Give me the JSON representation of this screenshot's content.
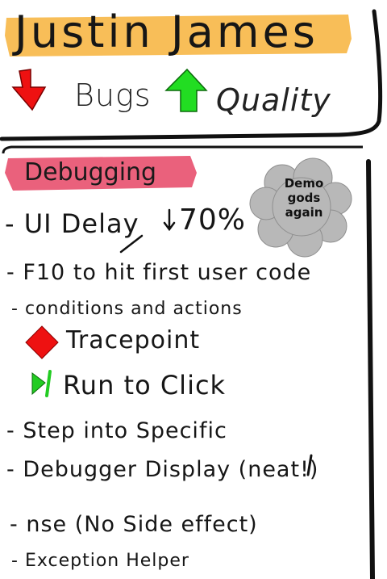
{
  "header": {
    "title": "Justin James",
    "bugs_label": "Bugs",
    "quality_label": "Quality",
    "colors": {
      "highlight": "#f7b84a",
      "down_arrow": "#ee1111",
      "up_arrow": "#22dd22"
    }
  },
  "section": {
    "title": "Debugging",
    "highlight_color": "#e8506e"
  },
  "cloud": {
    "line1": "Demo",
    "line2": "gods",
    "line3": "again",
    "color": "#b8b8b8"
  },
  "items": [
    {
      "dash": "-",
      "text": "UI Delay",
      "extra": "70%"
    },
    {
      "dash": "-",
      "text": "F10 to hit first user code"
    },
    {
      "dash": "-",
      "text": "conditions and actions"
    },
    {
      "dash": "",
      "text": "Tracepoint",
      "icon": "red-diamond-icon"
    },
    {
      "dash": "",
      "text": "Run to Click",
      "icon": "run-to-click-icon"
    },
    {
      "dash": "-",
      "text": "Step into Specific"
    },
    {
      "dash": "-",
      "text": "Debugger Display (neat!)"
    },
    {
      "dash": "-",
      "text": "nse (No Side effect)"
    },
    {
      "dash": "-",
      "text": "Exception Helper"
    }
  ]
}
